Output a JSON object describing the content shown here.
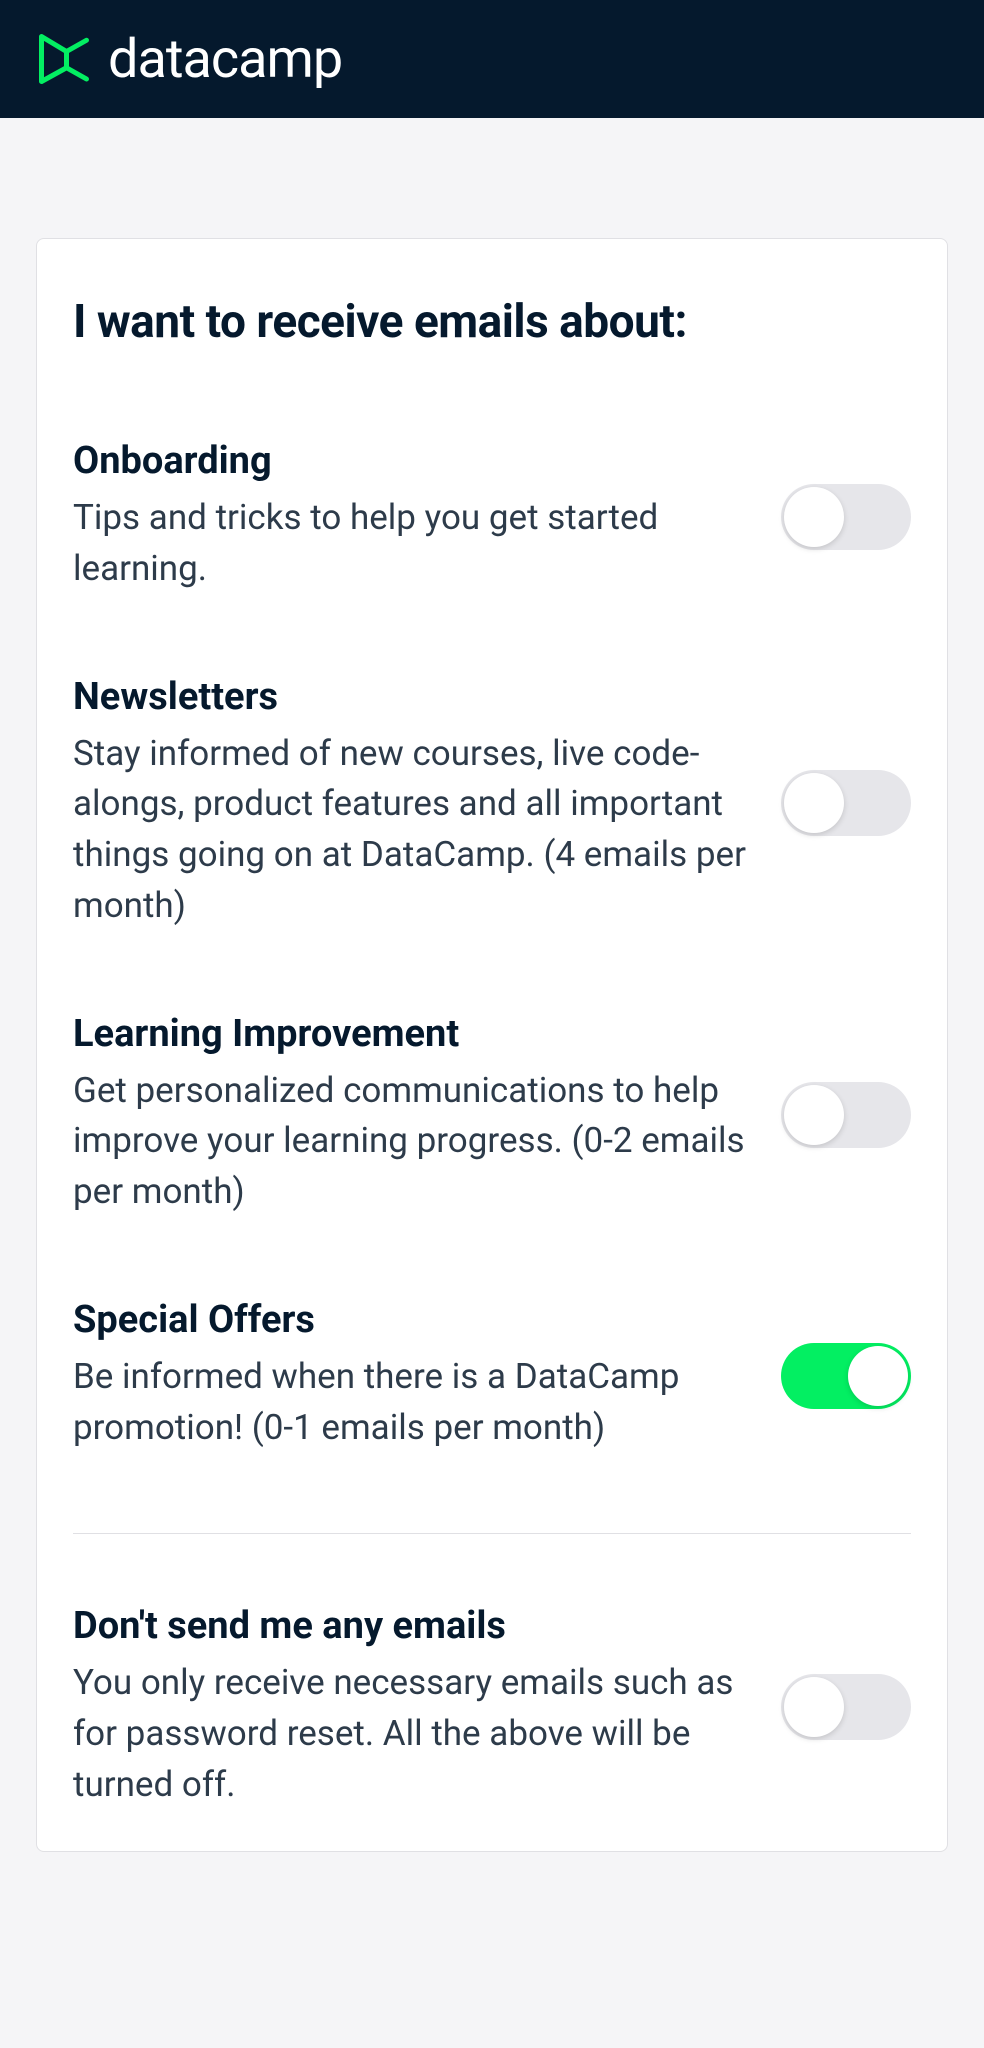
{
  "brand": {
    "name": "datacamp",
    "accent": "#03ef62"
  },
  "card": {
    "heading": "I want to receive emails about:"
  },
  "prefs": [
    {
      "key": "onboarding",
      "title": "Onboarding",
      "desc": "Tips and tricks to help you get started learning.",
      "enabled": false
    },
    {
      "key": "newsletters",
      "title": "Newsletters",
      "desc": "Stay informed of new courses, live code-alongs, product features and all important things going on at DataCamp. (4 emails per month)",
      "enabled": false
    },
    {
      "key": "learning-improvement",
      "title": "Learning Improvement",
      "desc": "Get personalized communications to help improve your learning progress. (0-2 emails per month)",
      "enabled": false
    },
    {
      "key": "special-offers",
      "title": "Special Offers",
      "desc": "Be informed when there is a DataCamp promotion! (0-1 emails per month)",
      "enabled": true
    }
  ],
  "optout": {
    "key": "no-emails",
    "title": "Don't send me any emails",
    "desc": "You only receive necessary emails such as for password reset. All the above will be turned off.",
    "enabled": false
  }
}
